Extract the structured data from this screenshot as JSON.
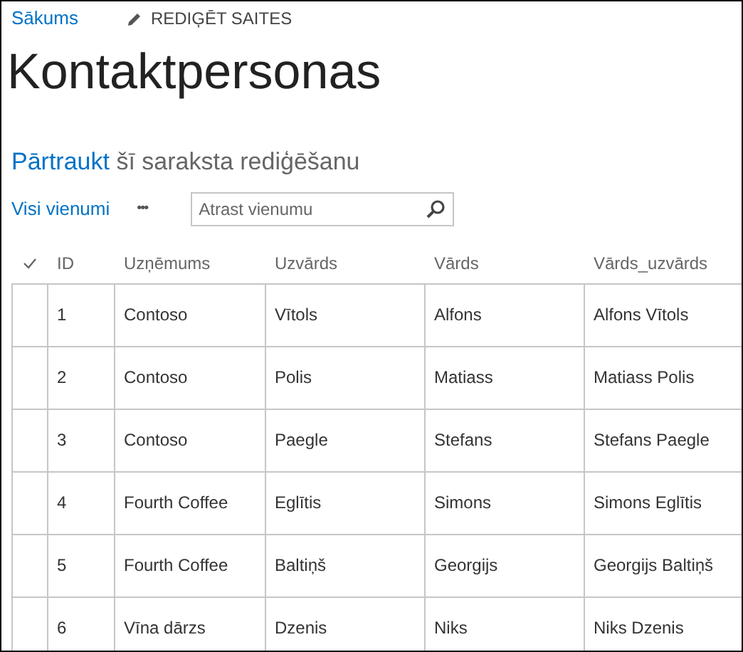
{
  "top_links": {
    "home": "Sākums",
    "edit_links": "REDIĢĒT SAITES"
  },
  "page_title": "Kontaktpersonas",
  "edit_notice": {
    "link": "Pārtraukt",
    "text": "šī saraksta rediģēšanu"
  },
  "view": {
    "name": "Visi vienumi",
    "more": "•••"
  },
  "search": {
    "placeholder": "Atrast vienumu"
  },
  "table": {
    "columns": [
      "ID",
      "Uzņēmums",
      "Uzvārds",
      "Vārds",
      "Vārds_uzvārds"
    ],
    "rows": [
      [
        "1",
        "Contoso",
        "Vītols",
        "Alfons",
        "Alfons Vītols"
      ],
      [
        "2",
        "Contoso",
        "Polis",
        "Matiass",
        "Matiass Polis"
      ],
      [
        "3",
        "Contoso",
        "Paegle",
        "Stefans",
        "Stefans Paegle"
      ],
      [
        "4",
        "Fourth Coffee",
        "Eglītis",
        "Simons",
        "Simons Eglītis"
      ],
      [
        "5",
        "Fourth Coffee",
        "Baltiņš",
        "Georgijs",
        "Georgijs Baltiņš"
      ],
      [
        "6",
        "Vīna dārzs",
        "Dzenis",
        "Niks",
        "Niks Dzenis"
      ]
    ]
  }
}
